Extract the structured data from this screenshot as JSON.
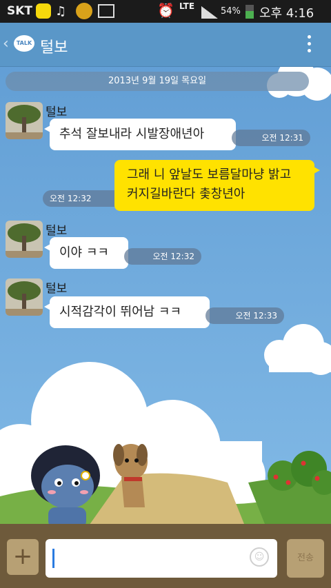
{
  "status_bar": {
    "carrier": "SKT",
    "network": "LTE",
    "battery": "54%",
    "time": "오후 4:16",
    "icons": [
      "kakaotalk-icon",
      "music-icon",
      "smiley-icon",
      "image-icon",
      "alarm-icon",
      "signal-icon",
      "battery-icon"
    ]
  },
  "header": {
    "back": "‹",
    "talk_badge": "TALK",
    "title": "털보"
  },
  "chat": {
    "date": "2013년 9월 19일 목요일",
    "messages": [
      {
        "sender": "털보",
        "text": "추석 잘보내라 시발장애년아",
        "time": "오전 12:31"
      },
      {
        "sender": "me",
        "text_line1": "그래 니 앞날도 보름달마냥 밝고",
        "text_line2": "커지길바란다 촟창년아",
        "time": "오전 12:32"
      },
      {
        "sender": "털보",
        "text": "이야 ㅋㅋ",
        "time": "오전 12:32"
      },
      {
        "sender": "털보",
        "text": "시적감각이 뛰어남 ㅋㅋ",
        "time": "오전 12:33"
      }
    ]
  },
  "input_bar": {
    "plus": "+",
    "send_label": "전송",
    "value": ""
  },
  "colors": {
    "sky": "#6fa8dc",
    "header": "#5a97c8",
    "my_bubble": "#ffe200",
    "input_bar": "#6e5a3b"
  }
}
